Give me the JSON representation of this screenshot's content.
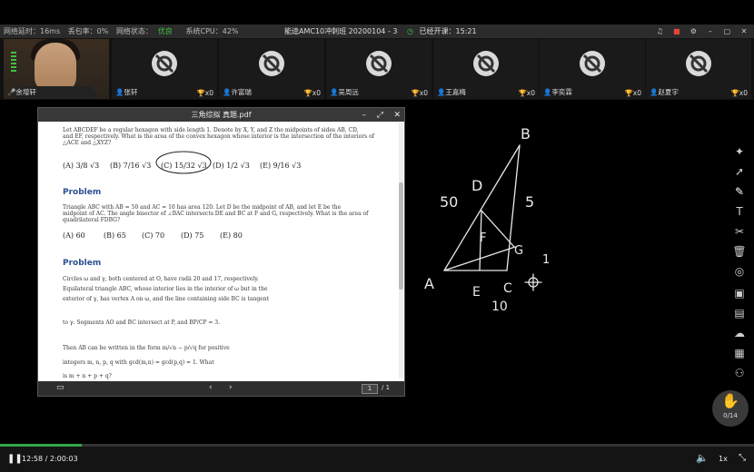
{
  "status": {
    "latency_label": "网络延时：16ms",
    "loss_label": "丢包率：0%",
    "net_label": "网络状态：",
    "net_value": "优良",
    "cpu_label": "系统CPU：42%",
    "course_title": "能逵AMC10冲刺班 20200104 - 3",
    "class_timer": "已经开课：15:21",
    "accent": "#3fbf3f"
  },
  "participants": [
    {
      "name": "余增轩",
      "trophies": ""
    },
    {
      "name": "张轩",
      "trophies": "x0"
    },
    {
      "name": "许富瑞",
      "trophies": "x0"
    },
    {
      "name": "吴周远",
      "trophies": "x0"
    },
    {
      "name": "王嘉梅",
      "trophies": "x0"
    },
    {
      "name": "李奕霖",
      "trophies": "x0"
    },
    {
      "name": "赵夏宇",
      "trophies": "x0"
    }
  ],
  "pdf": {
    "title": "三角综拟 真题.pdf",
    "p1_line1": "Let ABCDEF be a regular hexagon with side length 1. Denote by X, Y, and Z the midpoints of sides AB, CD,",
    "p1_line2": "and EF, respectively. What is the area of the convex hexagon whose interior is the intersection of the interiors of",
    "p1_line3": "△ACE and △XYZ?",
    "p1_answers": [
      "(A) 3/8 √3",
      "(B) 7/16 √3",
      "(C) 15/32 √3",
      "(D) 1/2 √3",
      "(E) 9/16 √3"
    ],
    "heading_1": "Problem",
    "p2_line1": "Triangle ABC with AB = 50 and AC = 10 has area 120. Let D be the midpoint of AB, and let E be the",
    "p2_line2": "midpoint of AC. The angle bisector of ∠BAC intersects DE and BC at F and G, respectively. What is the area of",
    "p2_line3": "quadrilateral FDBG?",
    "p2_answers": [
      "(A) 60",
      "(B) 65",
      "(C) 70",
      "(D) 75",
      "(E) 80"
    ],
    "heading_2": "Problem",
    "p3_line1": "Circles ω and γ, both centered at O, have radii 20 and 17, respectively.",
    "p3_line2": "Equilateral triangle ABC, whose interior lies in the interior of ω but in the",
    "p3_line3": "exterior of γ, has vertex A on ω, and the line containing side BC is tangent",
    "p3_line4": "to γ. Segments AO and BC intersect at P, and BP/CP = 3.",
    "p3_line5": "Then AB can be written in the form m/√n − p/√q for positive",
    "p3_line6": "integers m, n, p, q with gcd(m,n) = gcd(p,q) = 1. What",
    "p3_line7": "is m + n + p + q?",
    "page_current": "1",
    "page_total": "/ 1"
  },
  "handwriting": {
    "labels": [
      "B",
      "D",
      "50",
      "5",
      "F",
      "G",
      "1",
      "A",
      "E",
      "C",
      "10"
    ]
  },
  "raise_hand": {
    "count": "0/14"
  },
  "playback": {
    "time": "12:58 / 2:00:03",
    "speed": "1x",
    "progress": 0.108
  }
}
